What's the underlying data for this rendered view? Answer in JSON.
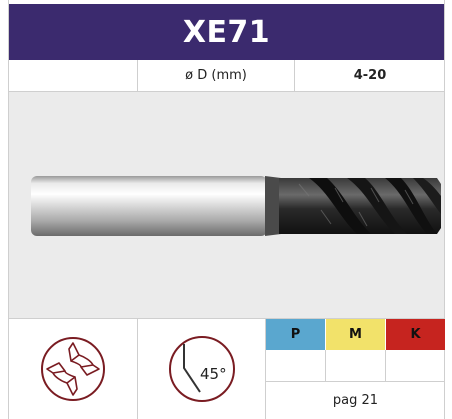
{
  "product": {
    "code": "XE71",
    "title_bg": "#3b2a6e"
  },
  "specs": {
    "diameter_label": "ø D (mm)",
    "diameter_value": "4-20"
  },
  "image": {
    "subject": "end-mill-cutter",
    "background": "#ebebeb"
  },
  "icons": {
    "cross_section": "end-mill-flute-section-icon",
    "chamfer": "chamfer-45-icon",
    "chamfer_label": "45°"
  },
  "materials": [
    {
      "code": "P",
      "color": "#5aa7cf"
    },
    {
      "code": "M",
      "color": "#f2e26a"
    },
    {
      "code": "K",
      "color": "#c6241f"
    }
  ],
  "footer": {
    "page_ref": "pag 21"
  }
}
